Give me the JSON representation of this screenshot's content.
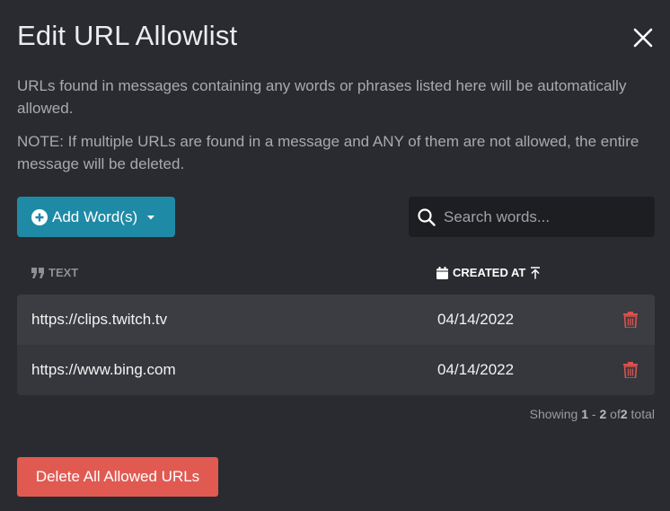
{
  "dialog": {
    "title": "Edit URL Allowlist",
    "description": "URLs found in messages containing any words or phrases listed here will be automatically allowed.",
    "note": "NOTE: If multiple URLs are found in a message and ANY of them are not allowed, the entire message will be deleted."
  },
  "toolbar": {
    "add_label": "Add Word(s)",
    "search_placeholder": "Search words..."
  },
  "table": {
    "columns": {
      "text": "TEXT",
      "created_at": "CREATED AT"
    },
    "rows": [
      {
        "text": "https://clips.twitch.tv",
        "created_at": "04/14/2022"
      },
      {
        "text": "https://www.bing.com",
        "created_at": "04/14/2022"
      }
    ]
  },
  "pagination": {
    "prefix": "Showing",
    "start": "1",
    "sep": "-",
    "end": "2",
    "of": "of",
    "total": "2",
    "suffix": "total"
  },
  "footer": {
    "delete_all_label": "Delete All Allowed URLs"
  },
  "icons": {
    "close": "close-icon",
    "add": "plus-circle-icon",
    "caret": "caret-down-icon",
    "search": "search-icon",
    "quote": "quote-icon",
    "calendar": "calendar-icon",
    "sort": "sort-ascending-icon",
    "delete": "trash-icon"
  },
  "colors": {
    "background": "#2a2b30",
    "accent": "#1f8aa6",
    "danger": "#e05a52"
  }
}
